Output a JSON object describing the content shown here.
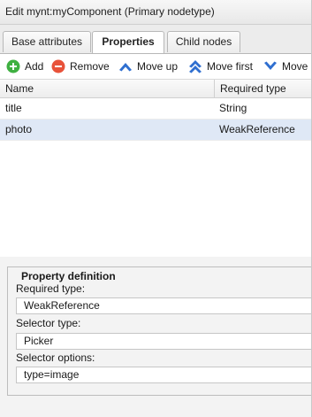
{
  "window": {
    "title": "Edit mynt:myComponent (Primary nodetype)"
  },
  "tabs": [
    {
      "label": "Base attributes",
      "active": false
    },
    {
      "label": "Properties",
      "active": true
    },
    {
      "label": "Child nodes",
      "active": false
    }
  ],
  "toolbar": {
    "add_label": "Add",
    "remove_label": "Remove",
    "move_up_label": "Move up",
    "move_first_label": "Move first",
    "move_down_label": "Move d"
  },
  "grid": {
    "columns": [
      "Name",
      "Required type"
    ],
    "rows": [
      {
        "name": "title",
        "required_type": "String",
        "selected": false
      },
      {
        "name": "photo",
        "required_type": "WeakReference",
        "selected": true
      }
    ]
  },
  "property_definition": {
    "legend": "Property definition",
    "required_type_label": "Required type:",
    "required_type_value": "WeakReference",
    "selector_type_label": "Selector type:",
    "selector_type_value": "Picker",
    "selector_options_label": "Selector options:",
    "selector_options_value": "type=image"
  },
  "colors": {
    "add_icon": "#3fb041",
    "remove_icon": "#e8523a",
    "move_icon": "#2f6fd0",
    "selected_row": "#dfe8f6"
  }
}
